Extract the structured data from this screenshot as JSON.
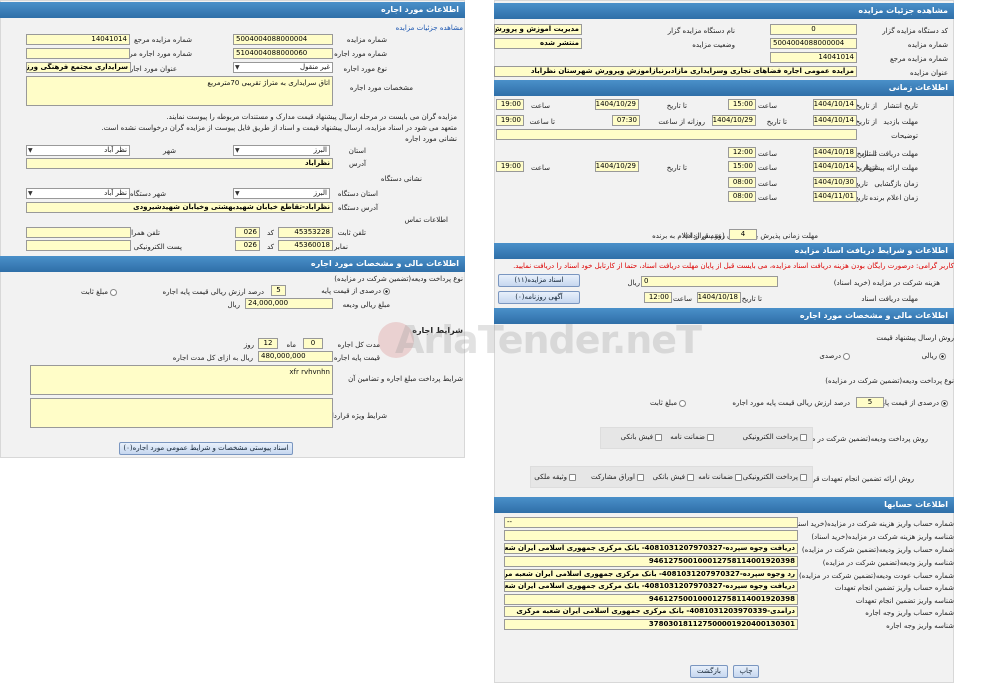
{
  "left": {
    "title": "اطلاعات مورد اجاره",
    "details_link": "مشاهده جزئیات مزایده",
    "ref_no_label": "شماره مزایده مرجع",
    "ref_no": "14041014",
    "auction_no_label": "شماره مزایده",
    "auction_no": "5004004088000004",
    "lease_ref_label": "شماره مورد اجاره مرجع",
    "lease_ref": "",
    "lease_no_label": "شماره مورد اجاره",
    "lease_no": "5104004088000060",
    "lease_title_label": "عنوان مورد اجاره",
    "lease_title": "سرایداری مجتمع فرهنگی ورزشی",
    "lease_type_label": "نوع مورد اجاره",
    "lease_type": "غیر منقول",
    "spec_label": "مشخصات مورد اجاره",
    "spec": "اتاق سرایداری به متراژ تقریبی 70مترمربع",
    "note1": "مزایده گران می بایست در مرحله ارسال پیشنهاد قیمت مدارک و مستندات مربوطه را پیوست نمایند.",
    "note2": "متعهد می شود در اسناد مزایده، ارسال پیشنهاد قیمت و اسناد از طریق فایل پیوست از مزایده گران درخواست نشده است.",
    "address_section": "نشانی مورد اجاره",
    "province_label": "استان",
    "province": "البرز",
    "city_label": "شهر",
    "city": "نظر آباد",
    "address_label": "آدرس",
    "address": "نظرآباد",
    "org_address_section": "نشانی دستگاه",
    "org_province_label": "استان دستگاه",
    "org_province": "البرز",
    "org_city_label": "شهر دستگاه",
    "org_city": "نظر آباد",
    "org_address_label": "آدرس دستگاه",
    "org_address": "نظرآباد-تقاطع خیابان شهیدبهشتی وخیابان شهیدشیرودی",
    "contact_section": "اطلاعات تماس",
    "phone_label": "تلفن ثابت",
    "phone": "45353228",
    "phone_code": "026",
    "code_label": "کد",
    "mobile_label": "تلفن همراه",
    "mobile": "",
    "fax_label": "نمابر",
    "fax": "45360018",
    "fax_code": "026",
    "email_label": "پست الکترونیکی",
    "email": "",
    "fin_title": "اطلاعات مالی و مشخصات مورد اجاره",
    "deposit_type_label": "نوع پرداخت ودیعه(تضمین شرکت در مزایده)",
    "percent_base_label": "درصدی از قیمت پایه",
    "percent_base": "5",
    "percent_text": "درصد ارزش ریالی قیمت پایه اجاره",
    "fixed_label": "مبلغ ثابت",
    "deposit_amount_label": "مبلغ ریالی ودیعه",
    "deposit_amount": "24,000,000",
    "rial": "ریال",
    "lease_cond_title": "شرایط اجاره",
    "duration_label": "مدت کل اجاره",
    "months": "0",
    "month_lbl": "ماه",
    "days": "12",
    "day_lbl": "روز",
    "base_price_label": "قیمت پایه اجاره",
    "base_price": "480,000,000",
    "base_price_suffix": "ریال به ازای کل مدت اجاره",
    "cond1_label": "شرایط پرداخت مبلغ اجاره و تضامین آن",
    "cond1": "xfr rvhvnhn",
    "cond2_label": "شرایط ویژه قرارداد",
    "cond2": "",
    "attach_btn": "اسناد پیوستی مشخصات و شرایط عمومی مورد اجاره(۰)"
  },
  "right": {
    "title": "مشاهده جزئیات مزایده",
    "org_code_label": "کد دستگاه مزایده گزار",
    "org_code": "0",
    "org_name_label": "نام دستگاه مزایده گزار",
    "org_name": "مدیریت آموزش و پرورش شه",
    "auction_no_label": "شماره مزایده",
    "auction_no": "5004004088000004",
    "status_label": "وضعیت مزایده",
    "status": "منتشر شده",
    "ref_no_label": "شماره مزایده مرجع",
    "ref_no": "14041014",
    "subject_label": "عنوان مزایده",
    "subject": "مزایده عمومی اجاره فضاهای تجاری وسرایداری  مازادبرنیازآموزش وپرورش شهرستان نظرآباد",
    "time_title": "اطلاعات زمانی",
    "publish_label": "تاریخ انتشار",
    "from_lbl": "از تاریخ",
    "to_lbl": "تا تاریخ",
    "hour_lbl": "ساعت",
    "pub_from": "1404/10/14",
    "pub_from_h": "15:00",
    "pub_to": "1404/10/29",
    "pub_to_h": "19:00",
    "visit_label": "مهلت بازدید",
    "visit_from": "1404/10/14",
    "visit_from_h": "15:00",
    "visit_daily": "روزانه از ساعت",
    "visit_daily_h": "07:30",
    "visit_to_h_lbl": "تا ساعت",
    "visit_to_h": "19:00",
    "visit_to": "1404/10/29",
    "desc_label": "توضیحات",
    "desc": "",
    "doc_deadline_label": "مهلت دریافت اسناد",
    "doc_to_lbl": "تا تاریخ",
    "doc_to": "1404/10/18",
    "doc_to_h": "12:00",
    "offer_deadline_label": "مهلت ارائه پیشنهاد",
    "offer_from": "1404/10/14",
    "offer_from_h": "15:00",
    "offer_to": "1404/10/29",
    "offer_to_h": "19:00",
    "open_label": "زمان بازگشایی",
    "date_lbl": "تاریخ",
    "open_date": "1404/10/30",
    "open_h": "08:00",
    "winner_label": "زمان اعلام برنده",
    "winner_date": "1404/11/01",
    "winner_h": "08:00",
    "accept_label": "مهلت زمانی پذیرش برنده بودن (عقد قرارداد)",
    "accept_days": "4",
    "accept_suffix": "روز پس از اعلام به برنده",
    "doc_title": "اطلاعات و شرایط دریافت اسناد مزایده",
    "warn": "کاربر گرامی: درصورت رایگان بودن هزینه دریافت اسناد مزایده، می بایست قبل از پایان مهلت دریافت اسناد، حتما از کارتابل خود اسناد را دریافت نمایید.",
    "doc_fee_label": "هزینه شرکت در مزایده (خرید اسناد)",
    "doc_fee": "0",
    "doc_fee_unit": "ریال",
    "doc_btn": "اسناد مزایده(۱۱)",
    "doc_get_label": "مهلت دریافت اسناد",
    "doc_get_to_lbl": "تا تاریخ",
    "doc_get_to": "1404/10/18",
    "doc_get_h_lbl": "ساعت",
    "doc_get_h": "12:00",
    "ad_btn": "آگهی روزنامه(۰)",
    "fin_title": "اطلاعات مالی و مشخصات مورد اجاره",
    "offer_method_label": "روش ارسال پیشنهاد قیمت",
    "rial_opt": "ریالی",
    "percent_opt": "درصدی",
    "deposit_type_label": "نوع پرداخت ودیعه(تضمین شرکت در مزایده)",
    "percent_base_label": "درصدی از قیمت پایه",
    "percent_base": "5",
    "percent_text": "درصد ارزش ریالی قیمت پایه مورد اجاره",
    "fixed_label": "مبلغ ثابت",
    "guar_label": "روش پرداخت ودیعه(تضمین شرکت در مزایده)",
    "electronic": "پرداخت الکترونیکی",
    "guarantee": "ضمانت نامه",
    "check": "فیش بانکی",
    "perf_label": "روش ارائه تضمین انجام تعهدات قرارداد",
    "securities": "اوراق مشارکت",
    "property": "وثیقه ملکی",
    "acc_title": "اطلاعات حسابها",
    "acc1_label": "شماره حساب واریز هزینه شرکت در مزایده(خرید اسناد)",
    "acc1": "--",
    "acc2_label": "شناسه واریز هزینه شرکت در مزایده(خرید اسناد)",
    "acc2": "",
    "acc3_label": "شماره حساب واریز ودیعه(تضمین شرکت در مزایده)",
    "acc3": "دریافت وجوه سپرده-4081031207970327- بانک مرکزی جمهوری اسلامی ایران شعبه مرکزی",
    "acc4_label": "شناسه واریز ودیعه(تضمین شرکت در مزایده)",
    "acc4": "946127500100012758114001920398",
    "acc5_label": "شماره حساب عودت ودیعه(تضمین شرکت در مزایده)",
    "acc5": "رد وجوه سپرده-4081031207970327- بانک مرکزی جمهوری اسلامی ایران شعبه مرکزی",
    "acc6_label": "شماره حساب واریز تضمین انجام تعهدات",
    "acc6": "دریافت وجوه سپرده-4081031207970327- بانک مرکزی جمهوری اسلامی ایران شعبه مرکزی",
    "acc7_label": "شناسه واریز تضمین انجام تعهدات",
    "acc7": "946127500100012758114001920398",
    "acc8_label": "شماره حساب واریز وجه اجاره",
    "acc8": "درآمدی-4081031203970339- بانک مرکزی جمهوری اسلامی ایران شعبه مرکزی",
    "acc9_label": "شناسه واریز وجه اجاره",
    "acc9": "378030181127500001920400130301",
    "print_btn": "چاپ",
    "back_btn": "بازگشت"
  },
  "watermark": "AriaTender.neT"
}
